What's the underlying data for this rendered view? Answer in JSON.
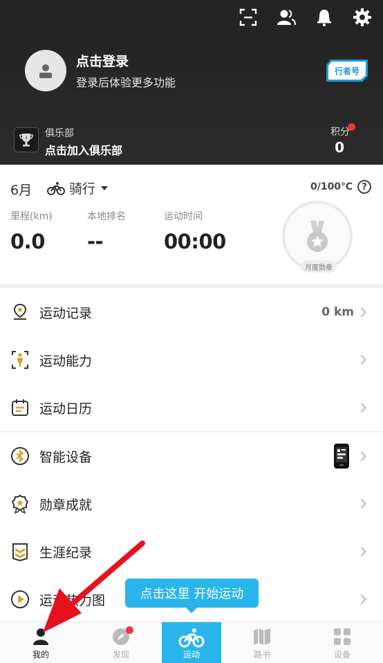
{
  "header": {
    "top_icons": [
      "scan-icon",
      "contacts-icon",
      "bell-icon",
      "gear-icon"
    ],
    "login_title": "点击登录",
    "login_subtitle": "登录后体验更多功能",
    "badge": "行者号",
    "club_label": "俱乐部",
    "club_cta": "点击加入俱乐部",
    "points_label": "积分",
    "points_value": "0"
  },
  "stats": {
    "month": "6月",
    "sport": "骑行",
    "temperature": "0/100℃",
    "help": "?",
    "items": [
      {
        "label": "里程(km)",
        "value": "0.0"
      },
      {
        "label": "本地排名",
        "value": "--"
      },
      {
        "label": "运动时间",
        "value": "00:00"
      }
    ],
    "medal_label": "月度勋章"
  },
  "menu": [
    {
      "label": "运动记录",
      "value": "0 km",
      "icon": "pin-icon"
    },
    {
      "label": "运动能力",
      "value": "",
      "icon": "body-icon"
    },
    {
      "label": "运动日历",
      "value": "",
      "icon": "calendar-icon"
    },
    {
      "label": "智能设备",
      "value": "",
      "icon": "bluetooth-icon"
    },
    {
      "label": "勋章成就",
      "value": "",
      "icon": "badge-icon"
    },
    {
      "label": "生涯纪录",
      "value": "",
      "icon": "rank-icon"
    },
    {
      "label": "运动热力图",
      "value": "",
      "icon": "heatmap-icon"
    }
  ],
  "tooltip": "点击这里 开始运动",
  "tabs": [
    {
      "label": "我的",
      "icon": "person-icon"
    },
    {
      "label": "发现",
      "icon": "compass-icon"
    },
    {
      "label": "运动",
      "icon": "bike-icon"
    },
    {
      "label": "路书",
      "icon": "map-icon"
    },
    {
      "label": "设备",
      "icon": "grid-icon"
    }
  ],
  "colors": {
    "accent": "#2ab4ec",
    "header_bg": "#262626",
    "notification": "#f3343a",
    "icon_gold": "#d6a52b",
    "annotation": "#e8101c"
  }
}
